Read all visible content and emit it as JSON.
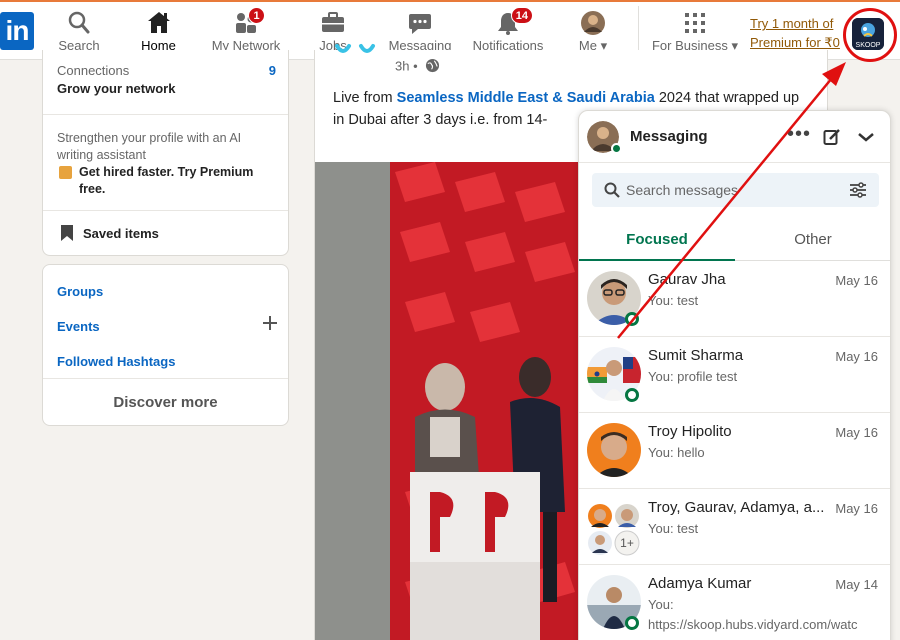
{
  "nav": {
    "logo": "in",
    "items": [
      {
        "label": "Search",
        "icon": "search-icon"
      },
      {
        "label": "Home",
        "icon": "home-icon",
        "active": true
      },
      {
        "label": "My Network",
        "icon": "network-icon",
        "badge": "1"
      },
      {
        "label": "Jobs",
        "icon": "briefcase-icon"
      },
      {
        "label": "Messaging",
        "icon": "messaging-icon"
      },
      {
        "label": "Notifications",
        "icon": "bell-icon",
        "badge": "14"
      },
      {
        "label": "Me",
        "icon": "avatar-icon"
      },
      {
        "label": "For Business",
        "icon": "grid-icon"
      }
    ],
    "premium_line1": "Try 1 month of",
    "premium_line2": "Premium for ₹0",
    "extension_label": "SKOOP"
  },
  "left": {
    "connections_label": "Connections",
    "connections_count": "9",
    "grow_label": "Grow your network",
    "ai_text": "Strengthen your profile with an AI writing assistant",
    "premium_cta": "Get hired faster. Try Premium free.",
    "saved_items": "Saved items",
    "groups": "Groups",
    "events": "Events",
    "followed_hashtags": "Followed Hashtags",
    "discover_more": "Discover more"
  },
  "post": {
    "time": "3h •",
    "text_before": "Live from ",
    "text_link": "Seamless Middle East & Saudi Arabia",
    "text_after": " 2024 that wrapped up in Dubai after 3 days i.e. from 14-"
  },
  "messaging": {
    "title": "Messaging",
    "search_placeholder": "Search messages",
    "tab_focused": "Focused",
    "tab_other": "Other",
    "conversations": [
      {
        "name": "Gaurav Jha",
        "preview": "You: test",
        "date": "May 16"
      },
      {
        "name": "Sumit Sharma",
        "preview": "You: profile test",
        "date": "May 16"
      },
      {
        "name": "Troy Hipolito",
        "preview": "You: hello",
        "date": "May 16"
      },
      {
        "name": "Troy, Gaurav, Adamya, a...",
        "preview": "You: test",
        "date": "May 16",
        "extra": "1+"
      },
      {
        "name": "Adamya Kumar",
        "preview": "You:",
        "preview2": "https://skoop.hubs.vidyard.com/watc",
        "date": "May 14"
      }
    ]
  },
  "colors": {
    "linkedin_blue": "#0a66c2",
    "online_green": "#057642",
    "badge_red": "#cc1016",
    "annotation_red": "#e01010",
    "premium_gold": "#915907"
  }
}
